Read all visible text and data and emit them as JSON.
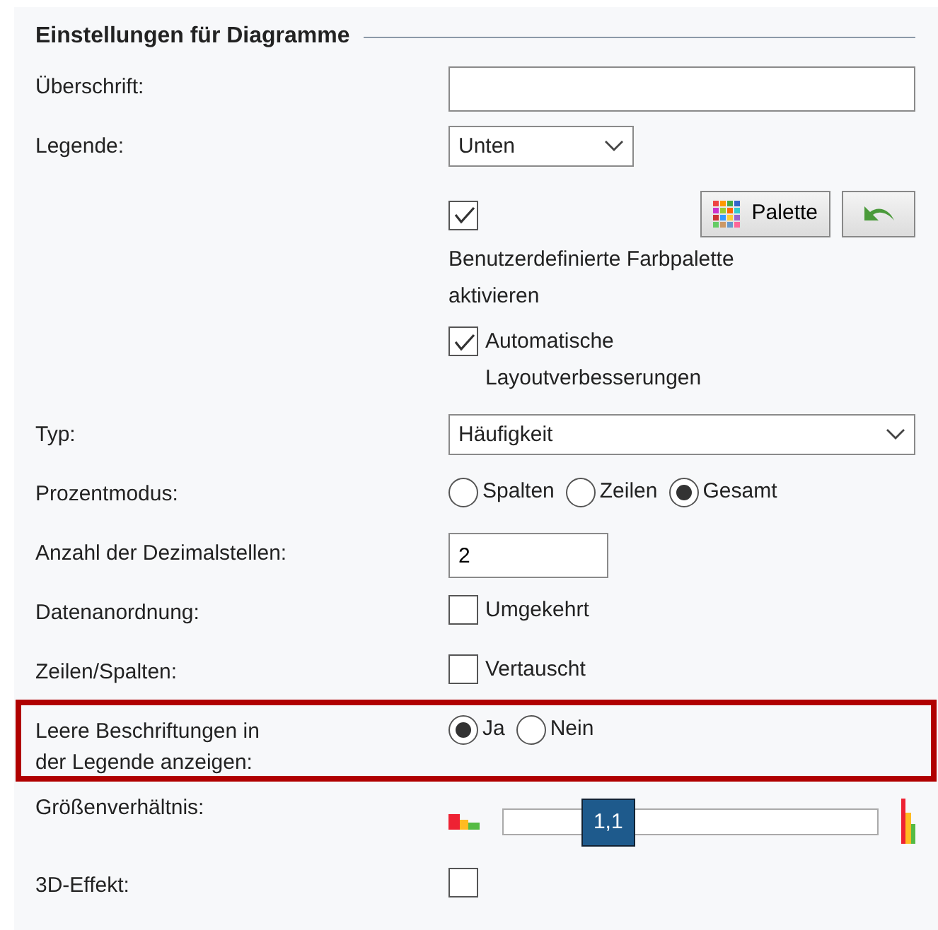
{
  "section": {
    "title": "Einstellungen für Diagramme"
  },
  "rows": [
    {
      "kind": "text",
      "label": "Überschrift:"
    },
    {
      "kind": "short_select",
      "label": "Legende:",
      "value": "Unten"
    },
    {
      "kind": "palette",
      "checked": true,
      "caption": "Benutzerdefinierte Farbpalette aktivieren",
      "button": "Palette"
    },
    {
      "kind": "check",
      "checked": true,
      "text": "Automatische Layoutverbesserungen"
    },
    {
      "kind": "select",
      "label": "Typ:",
      "value": "Häufigkeit"
    },
    {
      "kind": "radio",
      "label": "Prozentmodus:",
      "options": [
        {
          "text": "Spalten",
          "selected": false
        },
        {
          "text": "Zeilen",
          "selected": false
        },
        {
          "text": "Gesamt",
          "selected": true
        }
      ]
    },
    {
      "kind": "number",
      "label": "Anzahl der Dezimalstellen:",
      "value": "2"
    },
    {
      "kind": "check",
      "label": "Datenanordnung:",
      "checked": false,
      "text": "Umgekehrt"
    },
    {
      "kind": "check",
      "label": "Zeilen/Spalten:",
      "checked": false,
      "text": "Vertauscht"
    },
    {
      "kind": "radio",
      "label": "Leere Beschriftungen in der Legende anzeigen:",
      "highlighted": true,
      "options": [
        {
          "text": "Ja",
          "selected": true
        },
        {
          "text": "Nein",
          "selected": false
        }
      ]
    },
    {
      "kind": "slider",
      "label": "Größenverhältnis:",
      "level": 0.28,
      "reading": "1,1"
    },
    {
      "kind": "check",
      "label": "3D-Effekt:",
      "checked": false
    }
  ]
}
